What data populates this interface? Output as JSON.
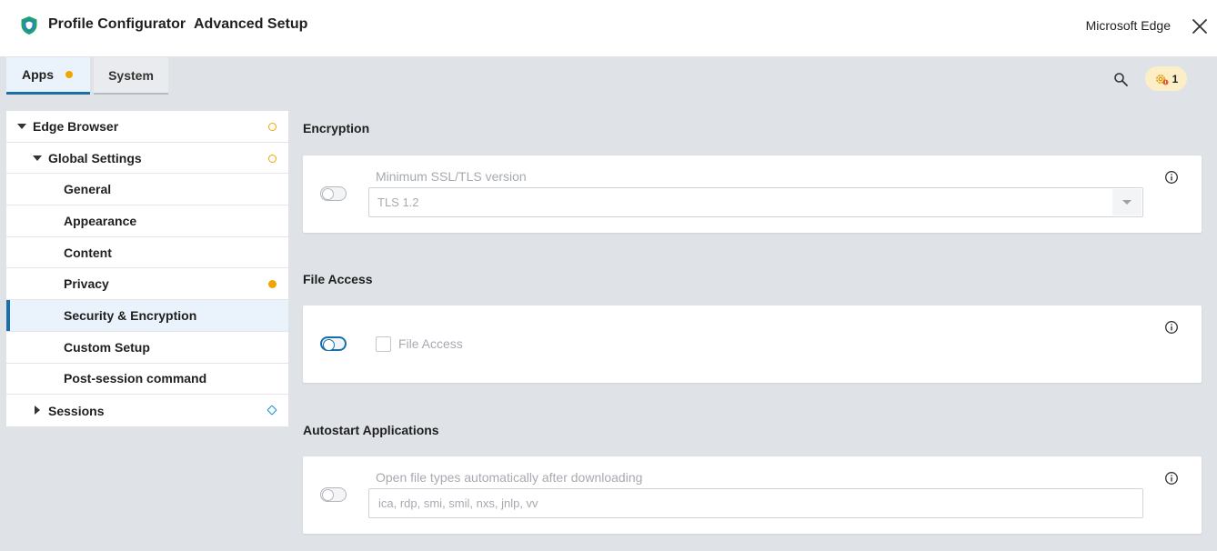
{
  "header": {
    "app_title": "Profile Configurator",
    "page_title": "Advanced Setup",
    "browser_name": "Microsoft Edge",
    "logo_icon": "shield-logo",
    "close_icon": "close-icon"
  },
  "tabs": [
    {
      "label": "Apps",
      "active": true,
      "indicator": "dot"
    },
    {
      "label": "System",
      "active": false
    }
  ],
  "toolbar": {
    "search_icon": "search-icon",
    "notification_icon": "gear-alert-icon",
    "notification_count": "1"
  },
  "sidebar": {
    "items": [
      {
        "label": "Edge Browser",
        "level": 0,
        "expanded": true,
        "indicator": "ring"
      },
      {
        "label": "Global Settings",
        "level": 1,
        "expanded": true,
        "indicator": "ring"
      },
      {
        "label": "General",
        "level": 2
      },
      {
        "label": "Appearance",
        "level": 2
      },
      {
        "label": "Content",
        "level": 2
      },
      {
        "label": "Privacy",
        "level": 2,
        "indicator": "dot"
      },
      {
        "label": "Security & Encryption",
        "level": 2,
        "active": true
      },
      {
        "label": "Custom Setup",
        "level": 2
      },
      {
        "label": "Post-session command",
        "level": 2
      },
      {
        "label": "Sessions",
        "level": 1,
        "expanded": false,
        "indicator": "diamond"
      }
    ]
  },
  "sections": {
    "encryption": {
      "title": "Encryption",
      "field_label": "Minimum SSL/TLS version",
      "selected_value": "TLS 1.2",
      "enabled": false
    },
    "file_access": {
      "title": "File Access",
      "checkbox_label": "File Access",
      "checked": false,
      "enabled": false
    },
    "autostart": {
      "title": "Autostart Applications",
      "field_label": "Open file types automatically after downloading",
      "placeholder": "ica, rdp, smi, smil, nxs, jnlp, vv",
      "enabled": false
    }
  },
  "colors": {
    "accent": "#1a6fa8",
    "warning": "#f0a500",
    "background": "#dfe2e6",
    "badge_bg": "#fcefc7"
  }
}
